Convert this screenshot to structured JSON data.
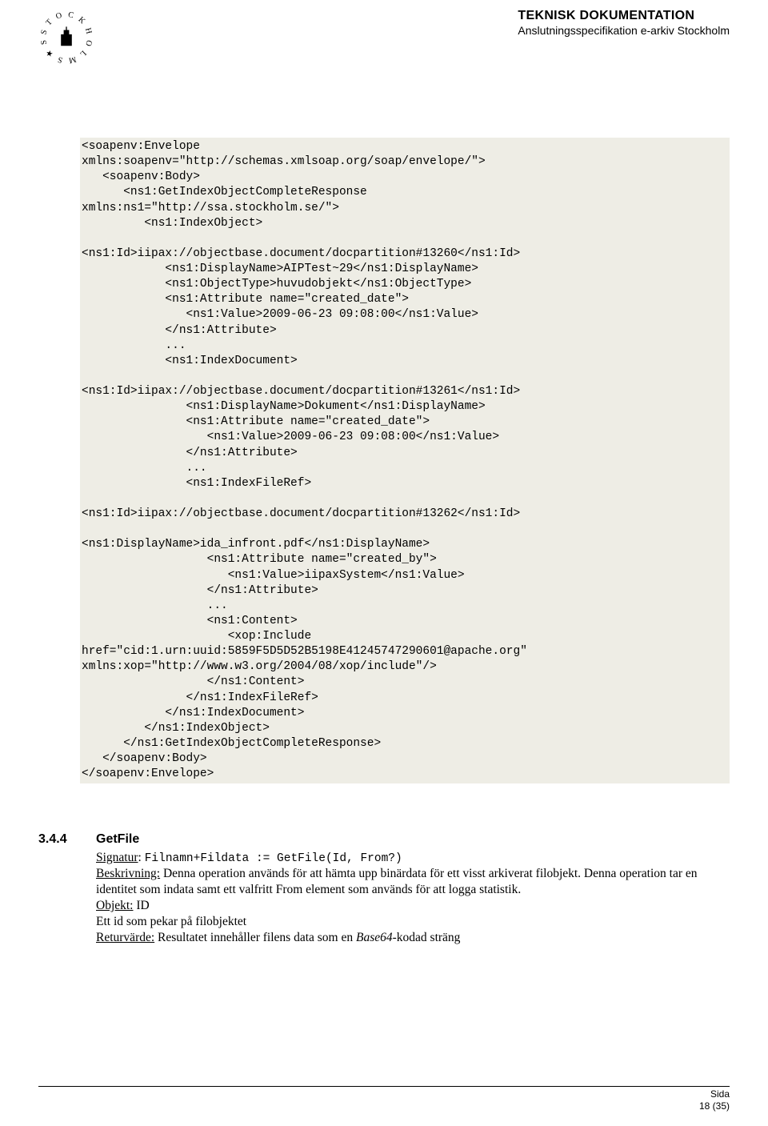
{
  "header": {
    "title": "TEKNISK DOKUMENTATION",
    "subtitle": "Anslutningsspecifikation e-arkiv Stockholm"
  },
  "code": "<soapenv:Envelope\nxmlns:soapenv=\"http://schemas.xmlsoap.org/soap/envelope/\">\n   <soapenv:Body>\n      <ns1:GetIndexObjectCompleteResponse\nxmlns:ns1=\"http://ssa.stockholm.se/\">\n         <ns1:IndexObject>\n\n<ns1:Id>iipax://objectbase.document/docpartition#13260</ns1:Id>\n            <ns1:DisplayName>AIPTest~29</ns1:DisplayName>\n            <ns1:ObjectType>huvudobjekt</ns1:ObjectType>\n            <ns1:Attribute name=\"created_date\">\n               <ns1:Value>2009-06-23 09:08:00</ns1:Value>\n            </ns1:Attribute>\n            ...\n            <ns1:IndexDocument>\n\n<ns1:Id>iipax://objectbase.document/docpartition#13261</ns1:Id>\n               <ns1:DisplayName>Dokument</ns1:DisplayName>\n               <ns1:Attribute name=\"created_date\">\n                  <ns1:Value>2009-06-23 09:08:00</ns1:Value>\n               </ns1:Attribute>\n               ...\n               <ns1:IndexFileRef>\n\n<ns1:Id>iipax://objectbase.document/docpartition#13262</ns1:Id>\n\n<ns1:DisplayName>ida_infront.pdf</ns1:DisplayName>\n                  <ns1:Attribute name=\"created_by\">\n                     <ns1:Value>iipaxSystem</ns1:Value>\n                  </ns1:Attribute>\n                  ...\n                  <ns1:Content>\n                     <xop:Include\nhref=\"cid:1.urn:uuid:5859F5D5D52B5198E41245747290601@apache.org\"\nxmlns:xop=\"http://www.w3.org/2004/08/xop/include\"/>\n                  </ns1:Content>\n               </ns1:IndexFileRef>\n            </ns1:IndexDocument>\n         </ns1:IndexObject>\n      </ns1:GetIndexObjectCompleteResponse>\n   </soapenv:Body>\n</soapenv:Envelope>",
  "section": {
    "num": "3.4.4",
    "title": "GetFile",
    "sig_label": "Signatur",
    "sig_value": "Filnamn+Fildata := GetFile(Id, From?)",
    "desc_label": "Beskrivning:",
    "desc_text": " Denna operation används för att hämta upp binärdata för ett visst arkiverat filobjekt. Denna operation tar en identitet som indata samt ett valfritt From element som används för att logga statistik.",
    "obj_label": "Objekt:",
    "obj_value": "  ID",
    "obj_desc": "Ett id som pekar på filobjektet",
    "ret_label": "Returvärde:",
    "ret_pre": "  Resultatet innehåller filens data som en ",
    "ret_italic": "Base64",
    "ret_post": "-kodad sträng"
  },
  "footer": {
    "label": "Sida",
    "page": "18 (35)"
  }
}
